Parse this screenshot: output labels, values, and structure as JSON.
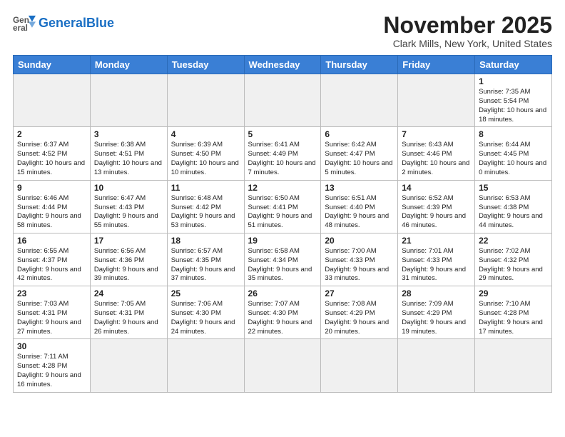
{
  "header": {
    "logo_general": "General",
    "logo_blue": "Blue",
    "month_title": "November 2025",
    "location": "Clark Mills, New York, United States"
  },
  "weekdays": [
    "Sunday",
    "Monday",
    "Tuesday",
    "Wednesday",
    "Thursday",
    "Friday",
    "Saturday"
  ],
  "weeks": [
    [
      {
        "day": "",
        "info": ""
      },
      {
        "day": "",
        "info": ""
      },
      {
        "day": "",
        "info": ""
      },
      {
        "day": "",
        "info": ""
      },
      {
        "day": "",
        "info": ""
      },
      {
        "day": "",
        "info": ""
      },
      {
        "day": "1",
        "info": "Sunrise: 7:35 AM\nSunset: 5:54 PM\nDaylight: 10 hours\nand 18 minutes."
      }
    ],
    [
      {
        "day": "2",
        "info": "Sunrise: 6:37 AM\nSunset: 4:52 PM\nDaylight: 10 hours\nand 15 minutes."
      },
      {
        "day": "3",
        "info": "Sunrise: 6:38 AM\nSunset: 4:51 PM\nDaylight: 10 hours\nand 13 minutes."
      },
      {
        "day": "4",
        "info": "Sunrise: 6:39 AM\nSunset: 4:50 PM\nDaylight: 10 hours\nand 10 minutes."
      },
      {
        "day": "5",
        "info": "Sunrise: 6:41 AM\nSunset: 4:49 PM\nDaylight: 10 hours\nand 7 minutes."
      },
      {
        "day": "6",
        "info": "Sunrise: 6:42 AM\nSunset: 4:47 PM\nDaylight: 10 hours\nand 5 minutes."
      },
      {
        "day": "7",
        "info": "Sunrise: 6:43 AM\nSunset: 4:46 PM\nDaylight: 10 hours\nand 2 minutes."
      },
      {
        "day": "8",
        "info": "Sunrise: 6:44 AM\nSunset: 4:45 PM\nDaylight: 10 hours\nand 0 minutes."
      }
    ],
    [
      {
        "day": "9",
        "info": "Sunrise: 6:46 AM\nSunset: 4:44 PM\nDaylight: 9 hours\nand 58 minutes."
      },
      {
        "day": "10",
        "info": "Sunrise: 6:47 AM\nSunset: 4:43 PM\nDaylight: 9 hours\nand 55 minutes."
      },
      {
        "day": "11",
        "info": "Sunrise: 6:48 AM\nSunset: 4:42 PM\nDaylight: 9 hours\nand 53 minutes."
      },
      {
        "day": "12",
        "info": "Sunrise: 6:50 AM\nSunset: 4:41 PM\nDaylight: 9 hours\nand 51 minutes."
      },
      {
        "day": "13",
        "info": "Sunrise: 6:51 AM\nSunset: 4:40 PM\nDaylight: 9 hours\nand 48 minutes."
      },
      {
        "day": "14",
        "info": "Sunrise: 6:52 AM\nSunset: 4:39 PM\nDaylight: 9 hours\nand 46 minutes."
      },
      {
        "day": "15",
        "info": "Sunrise: 6:53 AM\nSunset: 4:38 PM\nDaylight: 9 hours\nand 44 minutes."
      }
    ],
    [
      {
        "day": "16",
        "info": "Sunrise: 6:55 AM\nSunset: 4:37 PM\nDaylight: 9 hours\nand 42 minutes."
      },
      {
        "day": "17",
        "info": "Sunrise: 6:56 AM\nSunset: 4:36 PM\nDaylight: 9 hours\nand 39 minutes."
      },
      {
        "day": "18",
        "info": "Sunrise: 6:57 AM\nSunset: 4:35 PM\nDaylight: 9 hours\nand 37 minutes."
      },
      {
        "day": "19",
        "info": "Sunrise: 6:58 AM\nSunset: 4:34 PM\nDaylight: 9 hours\nand 35 minutes."
      },
      {
        "day": "20",
        "info": "Sunrise: 7:00 AM\nSunset: 4:33 PM\nDaylight: 9 hours\nand 33 minutes."
      },
      {
        "day": "21",
        "info": "Sunrise: 7:01 AM\nSunset: 4:33 PM\nDaylight: 9 hours\nand 31 minutes."
      },
      {
        "day": "22",
        "info": "Sunrise: 7:02 AM\nSunset: 4:32 PM\nDaylight: 9 hours\nand 29 minutes."
      }
    ],
    [
      {
        "day": "23",
        "info": "Sunrise: 7:03 AM\nSunset: 4:31 PM\nDaylight: 9 hours\nand 27 minutes."
      },
      {
        "day": "24",
        "info": "Sunrise: 7:05 AM\nSunset: 4:31 PM\nDaylight: 9 hours\nand 26 minutes."
      },
      {
        "day": "25",
        "info": "Sunrise: 7:06 AM\nSunset: 4:30 PM\nDaylight: 9 hours\nand 24 minutes."
      },
      {
        "day": "26",
        "info": "Sunrise: 7:07 AM\nSunset: 4:30 PM\nDaylight: 9 hours\nand 22 minutes."
      },
      {
        "day": "27",
        "info": "Sunrise: 7:08 AM\nSunset: 4:29 PM\nDaylight: 9 hours\nand 20 minutes."
      },
      {
        "day": "28",
        "info": "Sunrise: 7:09 AM\nSunset: 4:29 PM\nDaylight: 9 hours\nand 19 minutes."
      },
      {
        "day": "29",
        "info": "Sunrise: 7:10 AM\nSunset: 4:28 PM\nDaylight: 9 hours\nand 17 minutes."
      }
    ],
    [
      {
        "day": "30",
        "info": "Sunrise: 7:11 AM\nSunset: 4:28 PM\nDaylight: 9 hours\nand 16 minutes."
      },
      {
        "day": "",
        "info": ""
      },
      {
        "day": "",
        "info": ""
      },
      {
        "day": "",
        "info": ""
      },
      {
        "day": "",
        "info": ""
      },
      {
        "day": "",
        "info": ""
      },
      {
        "day": "",
        "info": ""
      }
    ]
  ]
}
